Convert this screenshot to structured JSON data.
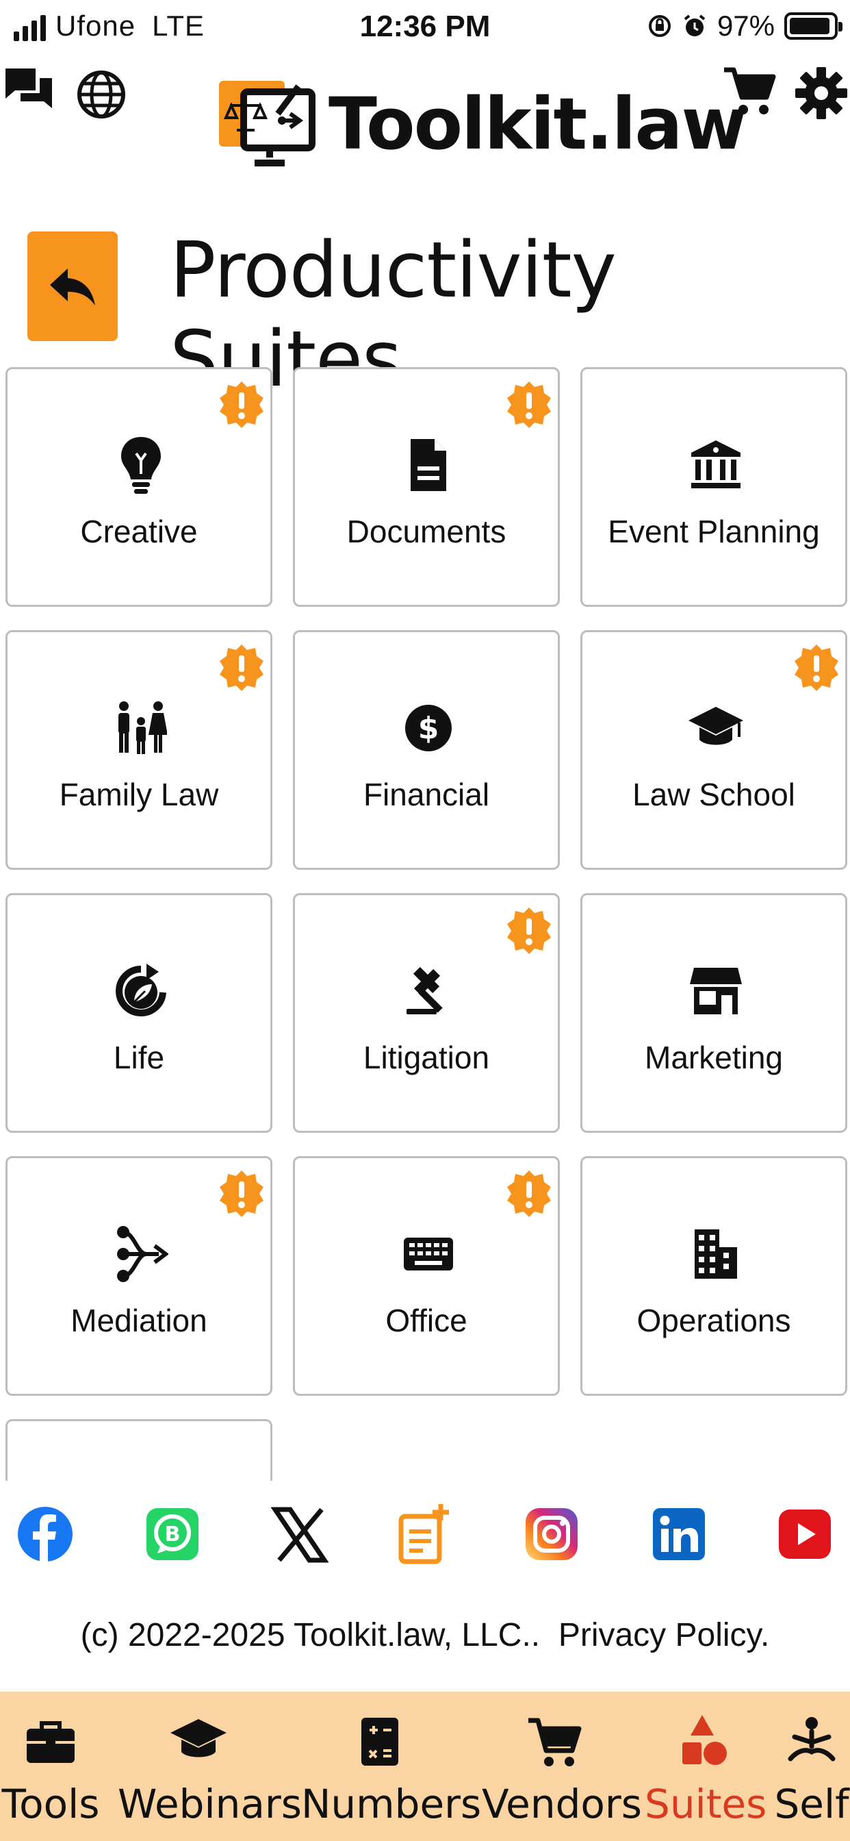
{
  "status_bar": {
    "carrier": "Ufone",
    "network": "LTE",
    "time": "12:36 PM",
    "battery": "97%"
  },
  "header": {
    "title": "Toolkit.law",
    "icons": [
      "chat-icon",
      "globe-icon",
      "cart-icon",
      "gear-icon"
    ]
  },
  "page": {
    "title": "Productivity Suites"
  },
  "colors": {
    "accent": "#f7941d",
    "nav_bg": "#fad4a2",
    "active_nav": "#d83a1f"
  },
  "tiles": [
    {
      "label": "Creative",
      "icon": "lightbulb-icon",
      "badge": true
    },
    {
      "label": "Documents",
      "icon": "document-icon",
      "badge": true
    },
    {
      "label": "Event Planning",
      "icon": "building-columns-icon",
      "badge": false
    },
    {
      "label": "Family Law",
      "icon": "family-icon",
      "badge": true
    },
    {
      "label": "Financial",
      "icon": "dollar-icon",
      "badge": false
    },
    {
      "label": "Law School",
      "icon": "graduation-cap-icon",
      "badge": true
    },
    {
      "label": "Life",
      "icon": "recycle-leaf-icon",
      "badge": false
    },
    {
      "label": "Litigation",
      "icon": "gavel-icon",
      "badge": true
    },
    {
      "label": "Marketing",
      "icon": "store-icon",
      "badge": false
    },
    {
      "label": "Mediation",
      "icon": "split-arrows-icon",
      "badge": true
    },
    {
      "label": "Office",
      "icon": "keyboard-icon",
      "badge": true
    },
    {
      "label": "Operations",
      "icon": "city-building-icon",
      "badge": false
    },
    {
      "label": "",
      "icon": "",
      "badge": false
    }
  ],
  "social": [
    "facebook-icon",
    "whatsapp-business-icon",
    "x-icon",
    "notes-add-icon",
    "instagram-icon",
    "linkedin-icon",
    "youtube-icon"
  ],
  "footer": {
    "copyright": "(c) 2022-2025 Toolkit.law, LLC..",
    "privacy": "Privacy Policy."
  },
  "bottom_nav": [
    {
      "label": "Tools",
      "icon": "briefcase-icon",
      "active": false
    },
    {
      "label": "Webinars",
      "icon": "graduation-cap-icon",
      "active": false
    },
    {
      "label": "Numbers",
      "icon": "calculator-icon",
      "active": false
    },
    {
      "label": "Vendors",
      "icon": "cart-icon",
      "active": false
    },
    {
      "label": "Suites",
      "icon": "shapes-icon",
      "active": true
    },
    {
      "label": "Self",
      "icon": "meditation-icon",
      "active": false
    }
  ]
}
